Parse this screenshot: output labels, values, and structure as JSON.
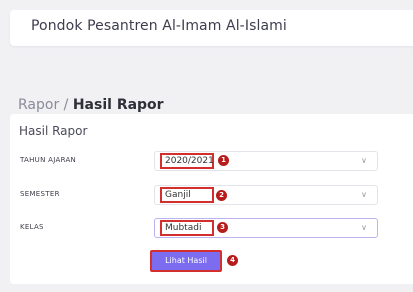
{
  "header": {
    "title": "Pondok Pesantren Al-Imam Al-Islami"
  },
  "breadcrumb": {
    "parent": "Rapor",
    "separator": " / ",
    "current": "Hasil Rapor"
  },
  "card": {
    "title": "Hasil Rapor",
    "fields": [
      {
        "label": "TAHUN AJARAN",
        "value": "2020/2021",
        "marker": "1"
      },
      {
        "label": "SEMESTER",
        "value": "Ganjil",
        "marker": "2"
      },
      {
        "label": "KELAS",
        "value": "Mubtadi",
        "marker": "3"
      }
    ],
    "button": {
      "label": "Lihat Hasil",
      "marker": "4"
    }
  },
  "colors": {
    "accent": "#7c6cf0",
    "highlight_border": "#d32f2f",
    "marker": "#b71c1c",
    "background": "#f1f1f4"
  },
  "icons": {
    "select_arrow": "chevron-down-icon"
  }
}
